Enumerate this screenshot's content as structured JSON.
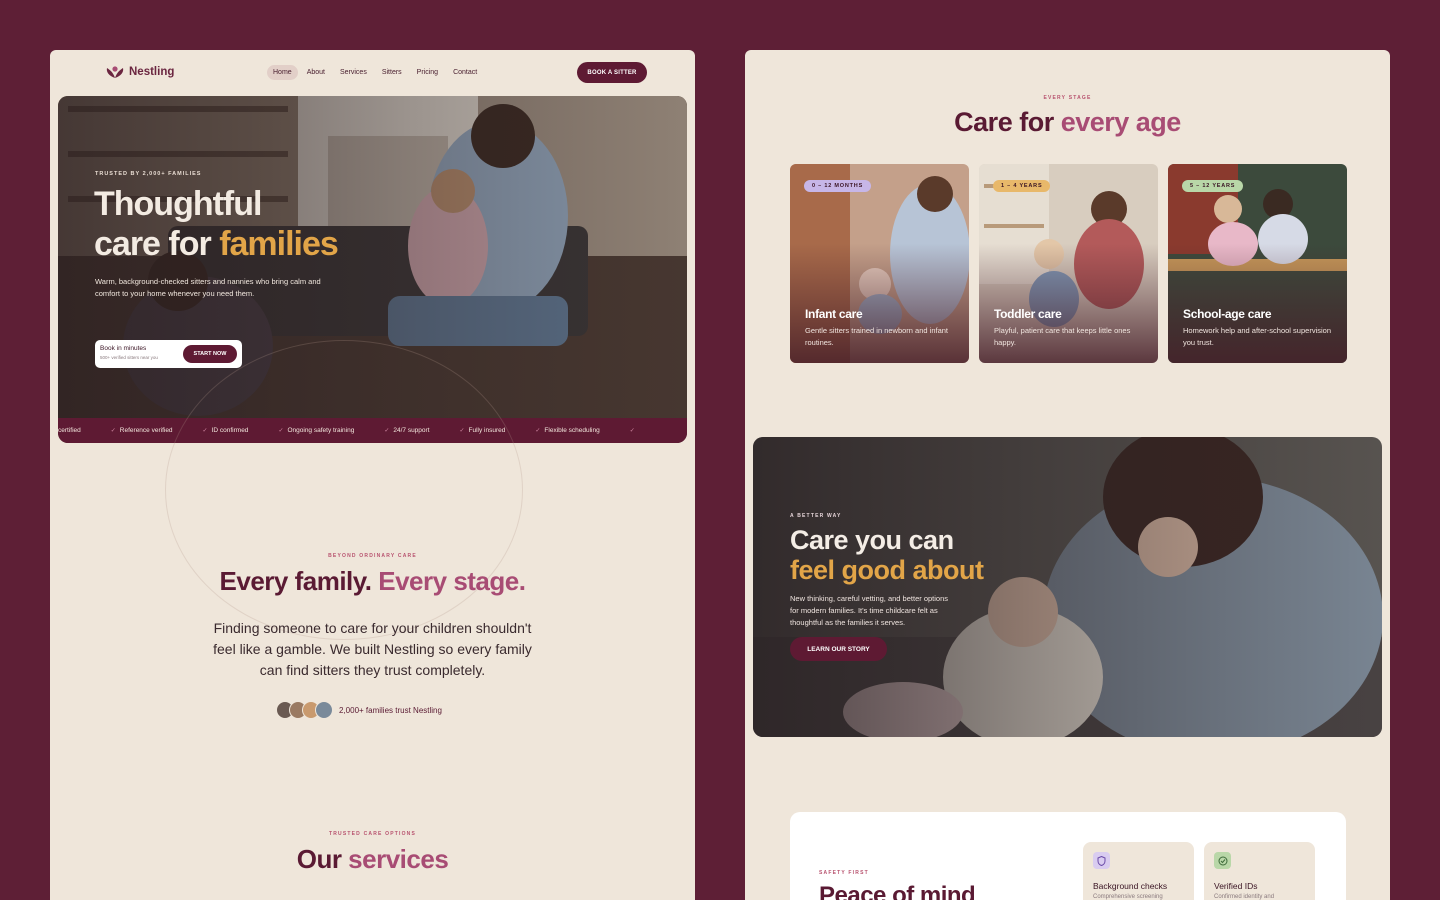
{
  "brand": {
    "name": "Nestling",
    "accent": "#5e1a33",
    "highlight": "#e2a548",
    "accent_pink": "#a84c74"
  },
  "nav": {
    "links": [
      {
        "label": "Home",
        "active": true
      },
      {
        "label": "About",
        "active": false
      },
      {
        "label": "Services",
        "active": false
      },
      {
        "label": "Sitters",
        "active": false
      },
      {
        "label": "Pricing",
        "active": false
      },
      {
        "label": "Contact",
        "active": false
      }
    ],
    "cta_label": "BOOK A SITTER"
  },
  "hero": {
    "eyebrow": "TRUSTED BY 2,000+ FAMILIES",
    "title_line1": "Thoughtful",
    "title_line2_plain": "care for ",
    "title_line2_accent": "families",
    "subtitle": "Warm, background-checked sitters and nannies who bring calm and comfort to your home whenever you need them.",
    "cta_title": "Book in minutes",
    "cta_sub": "500+ verified sitters near you",
    "cta_button": "START NOW"
  },
  "ticker": [
    "certified",
    "Reference verified",
    "ID confirmed",
    "Ongoing safety training",
    "24/7 support",
    "Fully insured",
    "Flexible scheduling"
  ],
  "about": {
    "eyebrow": "BEYOND ORDINARY CARE",
    "title_plain": "Every family. ",
    "title_accent": "Every stage.",
    "body": "Finding someone to care for your children shouldn't feel like a gamble. We built Nestling so every family can find sitters they trust completely.",
    "trust_text": "2,000+ families trust Nestling"
  },
  "services": {
    "eyebrow": "TRUSTED CARE OPTIONS",
    "title_plain": "Our ",
    "title_accent": "services"
  },
  "stages": {
    "eyebrow": "EVERY STAGE",
    "title_plain": "Care for ",
    "title_accent": "every age",
    "cards": [
      {
        "badge": "0 – 12 MONTHS",
        "badge_color": "#c7b6e8",
        "title": "Infant care",
        "desc": "Gentle sitters trained in newborn and infant routines."
      },
      {
        "badge": "1 – 4 YEARS",
        "badge_color": "#e8b86a",
        "title": "Toddler care",
        "desc": "Playful, patient care that keeps little ones happy."
      },
      {
        "badge": "5 – 12 YEARS",
        "badge_color": "#b9d7a8",
        "title": "School-age care",
        "desc": "Homework help and after-school supervision you trust."
      }
    ]
  },
  "better": {
    "eyebrow": "A BETTER WAY",
    "title_line1": "Care you can",
    "title_line2": "feel good about",
    "body": "New thinking, careful vetting, and better options for modern families. It's time childcare felt as thoughtful as the families it serves.",
    "button": "LEARN OUR STORY"
  },
  "safety": {
    "eyebrow": "SAFETY FIRST",
    "title": "Peace of mind",
    "features": [
      {
        "icon": "shield-icon",
        "title": "Background checks",
        "desc": "Comprehensive screening",
        "icon_bg": "#d9ccf0"
      },
      {
        "icon": "check-circle-icon",
        "title": "Verified IDs",
        "desc": "Confirmed identity and",
        "icon_bg": "#b9d7a8"
      }
    ]
  }
}
